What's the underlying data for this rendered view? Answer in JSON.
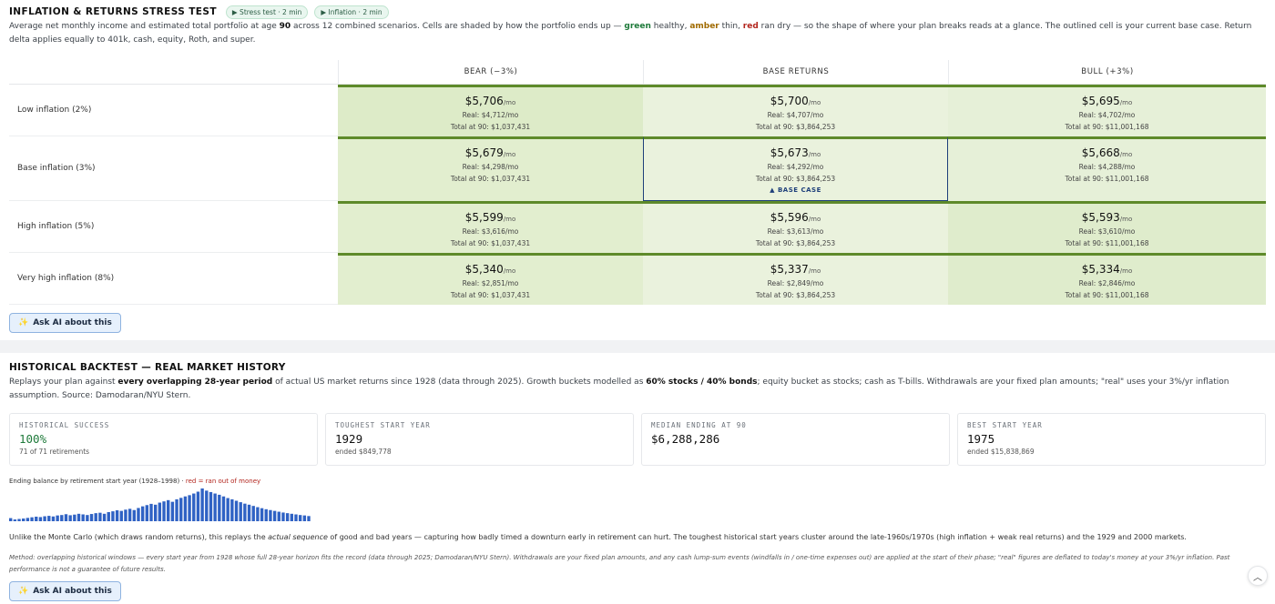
{
  "stress": {
    "title": "INFLATION & RETURNS STRESS TEST",
    "pills": [
      "▶ Stress test · 2 min",
      "▶ Inflation · 2 min"
    ],
    "desc_a": "Average net monthly income and estimated total portfolio at age ",
    "desc_age": "90",
    "desc_b": " across 12 combined scenarios. Cells are shaded by how the portfolio ends up — ",
    "green": "green",
    "desc_c": " healthy, ",
    "amber": "amber",
    "desc_d": " thin, ",
    "red": "red",
    "desc_e": " ran dry — so the shape of where your plan breaks reads at a glance. The outlined cell is your current base case. Return delta applies equally to 401k, cash, equity, Roth, and super.",
    "columns": [
      "BEAR (−3%)",
      "BASE RETURNS",
      "BULL (+3%)"
    ],
    "rows": [
      {
        "label": "Low inflation (2%)",
        "cells": [
          {
            "nominal": "$5,706",
            "real": "Real: $4,712/mo",
            "total": "Total at 90: $1,037,431"
          },
          {
            "nominal": "$5,700",
            "real": "Real: $4,707/mo",
            "total": "Total at 90: $3,864,253"
          },
          {
            "nominal": "$5,695",
            "real": "Real: $4,702/mo",
            "total": "Total at 90: $11,001,168"
          }
        ]
      },
      {
        "label": "Base inflation (3%)",
        "cells": [
          {
            "nominal": "$5,679",
            "real": "Real: $4,298/mo",
            "total": "Total at 90: $1,037,431"
          },
          {
            "nominal": "$5,673",
            "real": "Real: $4,292/mo",
            "total": "Total at 90: $3,864,253"
          },
          {
            "nominal": "$5,668",
            "real": "Real: $4,288/mo",
            "total": "Total at 90: $11,001,168"
          }
        ]
      },
      {
        "label": "High inflation (5%)",
        "cells": [
          {
            "nominal": "$5,599",
            "real": "Real: $3,616/mo",
            "total": "Total at 90: $1,037,431"
          },
          {
            "nominal": "$5,596",
            "real": "Real: $3,613/mo",
            "total": "Total at 90: $3,864,253"
          },
          {
            "nominal": "$5,593",
            "real": "Real: $3,610/mo",
            "total": "Total at 90: $11,001,168"
          }
        ]
      },
      {
        "label": "Very high inflation (8%)",
        "cells": [
          {
            "nominal": "$5,340",
            "real": "Real: $2,851/mo",
            "total": "Total at 90: $1,037,431"
          },
          {
            "nominal": "$5,337",
            "real": "Real: $2,849/mo",
            "total": "Total at 90: $3,864,253"
          },
          {
            "nominal": "$5,334",
            "real": "Real: $2,846/mo",
            "total": "Total at 90: $11,001,168"
          }
        ]
      }
    ],
    "per_month": "/mo",
    "base_case_label": "▲ BASE CASE",
    "ask_ai": "Ask AI about this"
  },
  "backtest": {
    "title": "HISTORICAL BACKTEST — REAL MARKET HISTORY",
    "desc_a": "Replays your plan against ",
    "desc_bold1": "every overlapping 28-year period",
    "desc_b": " of actual US market returns since 1928 (data through 2025). Growth buckets modelled as ",
    "desc_bold2": "60% stocks / 40% bonds",
    "desc_c": "; equity bucket as stocks; cash as T-bills. Withdrawals are your fixed plan amounts; \"real\" uses your 3%/yr inflation assumption. Source: Damodaran/NYU Stern.",
    "stats": [
      {
        "label": "HISTORICAL SUCCESS",
        "value": "100%",
        "foot": "71 of 71 retirements"
      },
      {
        "label": "TOUGHEST START YEAR",
        "value": "1929",
        "foot": "ended $849,778"
      },
      {
        "label": "MEDIAN ENDING AT 90",
        "value": "$6,288,286",
        "foot": ""
      },
      {
        "label": "BEST START YEAR",
        "value": "1975",
        "foot": "ended $15,838,869"
      }
    ],
    "chart_caption": "Ending balance by retirement start year (1928–1998) · ",
    "chart_caption_red": "red = ran out of money",
    "body_a": "Unlike the Monte Carlo (which draws random returns), this replays the ",
    "body_em": "actual sequence",
    "body_b": " of good and bad years — capturing how badly timed a downturn early in retirement can hurt. The toughest historical start years cluster around the late-1960s/1970s (high inflation + weak real returns) and the 1929 and 2000 markets.",
    "method": "Method: overlapping historical windows — every start year from 1928 whose full 28-year horizon fits the record (data through 2025; Damodaran/NYU Stern). Withdrawals are your fixed plan amounts, and any cash lump-sum events (windfalls in / one-time expenses out) are applied at the start of their phase; \"real\" figures are deflated to today's money at your 3%/yr inflation. Past performance is not a guarantee of future results.",
    "ask_ai": "Ask AI about this"
  },
  "chart_data": {
    "type": "bar",
    "title": "Ending balance by retirement start year (1928–1998)",
    "x_range": [
      1928,
      1998
    ],
    "bar_color": "#2f62c4",
    "fail_color": "#b3261e",
    "values": [
      1.5,
      0.85,
      1.1,
      1.3,
      1.6,
      1.9,
      2.2,
      2.0,
      2.4,
      2.6,
      2.3,
      2.8,
      3.0,
      3.4,
      2.9,
      3.2,
      3.6,
      3.3,
      3.0,
      3.5,
      3.9,
      4.1,
      3.6,
      4.4,
      4.8,
      5.3,
      5.0,
      5.6,
      6.0,
      5.4,
      6.4,
      7.2,
      7.8,
      8.4,
      8.0,
      9.0,
      9.6,
      10.2,
      9.4,
      10.6,
      11.3,
      12.0,
      12.6,
      13.4,
      14.3,
      15.84,
      14.8,
      14.1,
      13.4,
      12.8,
      12.0,
      11.2,
      10.6,
      9.9,
      9.2,
      8.5,
      8.0,
      7.4,
      6.8,
      6.3,
      5.8,
      5.4,
      5.0,
      4.6,
      4.2,
      3.9,
      3.6,
      3.3,
      3.0,
      2.8,
      2.5
    ],
    "failed": []
  },
  "scroll_top_icon": "︿"
}
